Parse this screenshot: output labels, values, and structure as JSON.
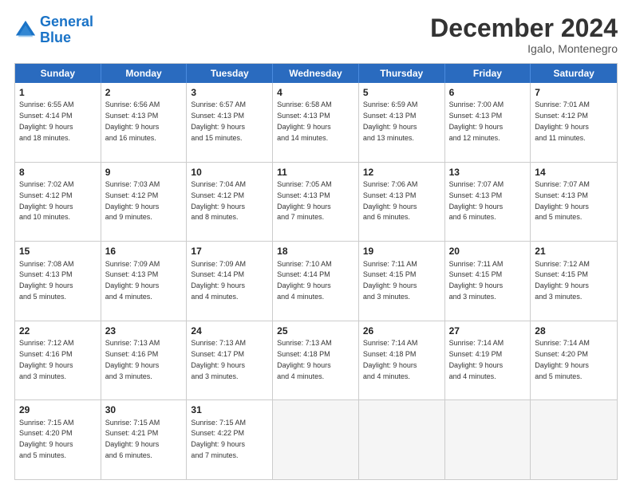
{
  "header": {
    "logo_line1": "General",
    "logo_line2": "Blue",
    "month": "December 2024",
    "location": "Igalo, Montenegro"
  },
  "days_of_week": [
    "Sunday",
    "Monday",
    "Tuesday",
    "Wednesday",
    "Thursday",
    "Friday",
    "Saturday"
  ],
  "weeks": [
    [
      {
        "day": "1",
        "sunrise": "6:55 AM",
        "sunset": "4:14 PM",
        "daylight": "9 hours and 18 minutes."
      },
      {
        "day": "2",
        "sunrise": "6:56 AM",
        "sunset": "4:13 PM",
        "daylight": "9 hours and 16 minutes."
      },
      {
        "day": "3",
        "sunrise": "6:57 AM",
        "sunset": "4:13 PM",
        "daylight": "9 hours and 15 minutes."
      },
      {
        "day": "4",
        "sunrise": "6:58 AM",
        "sunset": "4:13 PM",
        "daylight": "9 hours and 14 minutes."
      },
      {
        "day": "5",
        "sunrise": "6:59 AM",
        "sunset": "4:13 PM",
        "daylight": "9 hours and 13 minutes."
      },
      {
        "day": "6",
        "sunrise": "7:00 AM",
        "sunset": "4:13 PM",
        "daylight": "9 hours and 12 minutes."
      },
      {
        "day": "7",
        "sunrise": "7:01 AM",
        "sunset": "4:12 PM",
        "daylight": "9 hours and 11 minutes."
      }
    ],
    [
      {
        "day": "8",
        "sunrise": "7:02 AM",
        "sunset": "4:12 PM",
        "daylight": "9 hours and 10 minutes."
      },
      {
        "day": "9",
        "sunrise": "7:03 AM",
        "sunset": "4:12 PM",
        "daylight": "9 hours and 9 minutes."
      },
      {
        "day": "10",
        "sunrise": "7:04 AM",
        "sunset": "4:12 PM",
        "daylight": "9 hours and 8 minutes."
      },
      {
        "day": "11",
        "sunrise": "7:05 AM",
        "sunset": "4:13 PM",
        "daylight": "9 hours and 7 minutes."
      },
      {
        "day": "12",
        "sunrise": "7:06 AM",
        "sunset": "4:13 PM",
        "daylight": "9 hours and 6 minutes."
      },
      {
        "day": "13",
        "sunrise": "7:07 AM",
        "sunset": "4:13 PM",
        "daylight": "9 hours and 6 minutes."
      },
      {
        "day": "14",
        "sunrise": "7:07 AM",
        "sunset": "4:13 PM",
        "daylight": "9 hours and 5 minutes."
      }
    ],
    [
      {
        "day": "15",
        "sunrise": "7:08 AM",
        "sunset": "4:13 PM",
        "daylight": "9 hours and 5 minutes."
      },
      {
        "day": "16",
        "sunrise": "7:09 AM",
        "sunset": "4:13 PM",
        "daylight": "9 hours and 4 minutes."
      },
      {
        "day": "17",
        "sunrise": "7:09 AM",
        "sunset": "4:14 PM",
        "daylight": "9 hours and 4 minutes."
      },
      {
        "day": "18",
        "sunrise": "7:10 AM",
        "sunset": "4:14 PM",
        "daylight": "9 hours and 4 minutes."
      },
      {
        "day": "19",
        "sunrise": "7:11 AM",
        "sunset": "4:15 PM",
        "daylight": "9 hours and 3 minutes."
      },
      {
        "day": "20",
        "sunrise": "7:11 AM",
        "sunset": "4:15 PM",
        "daylight": "9 hours and 3 minutes."
      },
      {
        "day": "21",
        "sunrise": "7:12 AM",
        "sunset": "4:15 PM",
        "daylight": "9 hours and 3 minutes."
      }
    ],
    [
      {
        "day": "22",
        "sunrise": "7:12 AM",
        "sunset": "4:16 PM",
        "daylight": "9 hours and 3 minutes."
      },
      {
        "day": "23",
        "sunrise": "7:13 AM",
        "sunset": "4:16 PM",
        "daylight": "9 hours and 3 minutes."
      },
      {
        "day": "24",
        "sunrise": "7:13 AM",
        "sunset": "4:17 PM",
        "daylight": "9 hours and 3 minutes."
      },
      {
        "day": "25",
        "sunrise": "7:13 AM",
        "sunset": "4:18 PM",
        "daylight": "9 hours and 4 minutes."
      },
      {
        "day": "26",
        "sunrise": "7:14 AM",
        "sunset": "4:18 PM",
        "daylight": "9 hours and 4 minutes."
      },
      {
        "day": "27",
        "sunrise": "7:14 AM",
        "sunset": "4:19 PM",
        "daylight": "9 hours and 4 minutes."
      },
      {
        "day": "28",
        "sunrise": "7:14 AM",
        "sunset": "4:20 PM",
        "daylight": "9 hours and 5 minutes."
      }
    ],
    [
      {
        "day": "29",
        "sunrise": "7:15 AM",
        "sunset": "4:20 PM",
        "daylight": "9 hours and 5 minutes."
      },
      {
        "day": "30",
        "sunrise": "7:15 AM",
        "sunset": "4:21 PM",
        "daylight": "9 hours and 6 minutes."
      },
      {
        "day": "31",
        "sunrise": "7:15 AM",
        "sunset": "4:22 PM",
        "daylight": "9 hours and 7 minutes."
      },
      null,
      null,
      null,
      null
    ]
  ]
}
